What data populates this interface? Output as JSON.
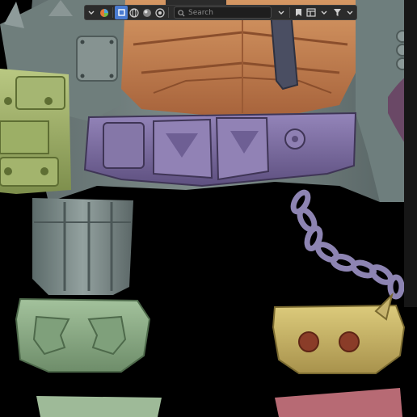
{
  "toolbar": {
    "search_placeholder": "Search",
    "icons": [
      "chevron-down-icon",
      "color-sphere-icon",
      "select-box-icon",
      "globe-icon",
      "render-sphere-icon",
      "material-sphere-icon",
      "filter-icon",
      "bookmark-icon",
      "layout-icon",
      "funnel-icon"
    ]
  },
  "scene": {
    "description_colors": {
      "chest": "#c98452",
      "belt": "#7b6ba0",
      "arm_green": "#a3b56a",
      "gauntlet_gray": "#7e8a88",
      "kneepad_green": "#8cae88",
      "kneepad_gold": "#c9b86a",
      "chain": "#8c83b0",
      "purple_shoulder": "#5a3a58"
    }
  }
}
